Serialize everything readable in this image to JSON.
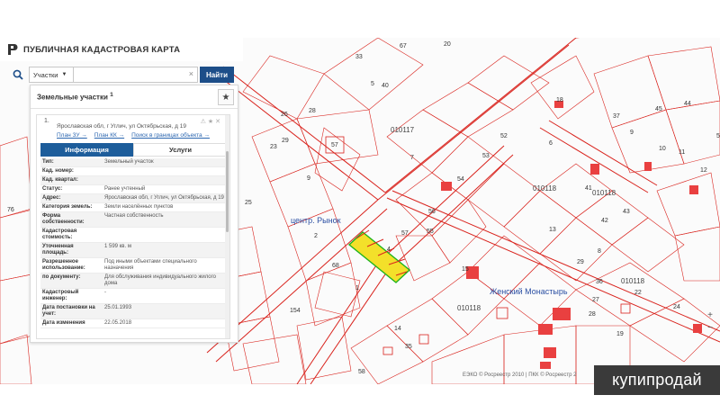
{
  "colors": {
    "cadastral_line": "#d9231d",
    "road": "#e7a3a3",
    "building": "#e94040",
    "parcel_highlight_fill": "#f3e02a",
    "parcel_highlight_stroke": "#1db31d",
    "accent": "#1d5d9b"
  },
  "app": {
    "title": "ПУБЛИЧНАЯ КАДАСТРОВАЯ КАРТА",
    "logo_icon": "rosreestr-logo-icon"
  },
  "search": {
    "icon": "search-icon",
    "type_value": "Участки",
    "input_value": "",
    "clear_icon": "×",
    "button_label": "Найти"
  },
  "panel": {
    "heading": "Земельные участки",
    "heading_count": "1",
    "favorite_icon": "★",
    "item_number": "1.",
    "item_address": "Ярославская обл, г Углич, ул Октябрьская, д 19",
    "item_icons": "⚠★✕",
    "links": [
      "План ЗУ →",
      "План КК →",
      "Поиск в границах объекта →"
    ],
    "tabs": [
      "Информация",
      "Услуги"
    ],
    "rows": [
      {
        "k": "Тип:",
        "v": "Земельный участок"
      },
      {
        "k": "Кад. номер:",
        "v": ""
      },
      {
        "k": "Кад. квартал:",
        "v": ""
      },
      {
        "k": "Статус:",
        "v": "Ранее учтенный"
      },
      {
        "k": "Адрес:",
        "v": "Ярославская обл, г Углич, ул Октябрьская, д 19"
      },
      {
        "k": "Категория земель:",
        "v": "Земли населённых пунктов"
      },
      {
        "k": "Форма собственности:",
        "v": "Частная собственность"
      },
      {
        "k": "Кадастровая стоимость:",
        "v": ""
      },
      {
        "k": "Уточненная площадь:",
        "v": "1 599 кв. м"
      },
      {
        "k": "Разрешенное использование:",
        "v": "Под иными объектами специального назначения"
      },
      {
        "k": "по документу:",
        "v": "Для обслуживания индивидуального жилого дома"
      },
      {
        "k": "Кадастровый инженер:",
        "v": "-"
      },
      {
        "k": "Дата постановки на учет:",
        "v": "25.01.1993"
      },
      {
        "k": "Дата изменения",
        "v": "22.05.2018"
      }
    ]
  },
  "map": {
    "labels": [
      "010117",
      "010118",
      "010118",
      "010118",
      "010118",
      "центр. Рынок",
      "Женский Монастырь",
      "33",
      "40",
      "67",
      "20",
      "18",
      "37",
      "45",
      "44",
      "28",
      "26",
      "29",
      "23",
      "57",
      "9",
      "5",
      "7",
      "53",
      "54",
      "52",
      "6",
      "9",
      "10",
      "11",
      "12",
      "13",
      "41",
      "42",
      "43",
      "8",
      "2",
      "57",
      "4",
      "56",
      "55",
      "58",
      "15",
      "68",
      "1",
      "154",
      "14",
      "35",
      "36",
      "27",
      "28",
      "29",
      "19",
      "22",
      "24",
      "25",
      "76",
      "54",
      "12"
    ],
    "zoom_in": "+",
    "zoom_out": "−"
  },
  "footer": "ЕЭКО © Росреестр 2010 | ПКК © Росреестр 2",
  "watermark": "купипродай"
}
